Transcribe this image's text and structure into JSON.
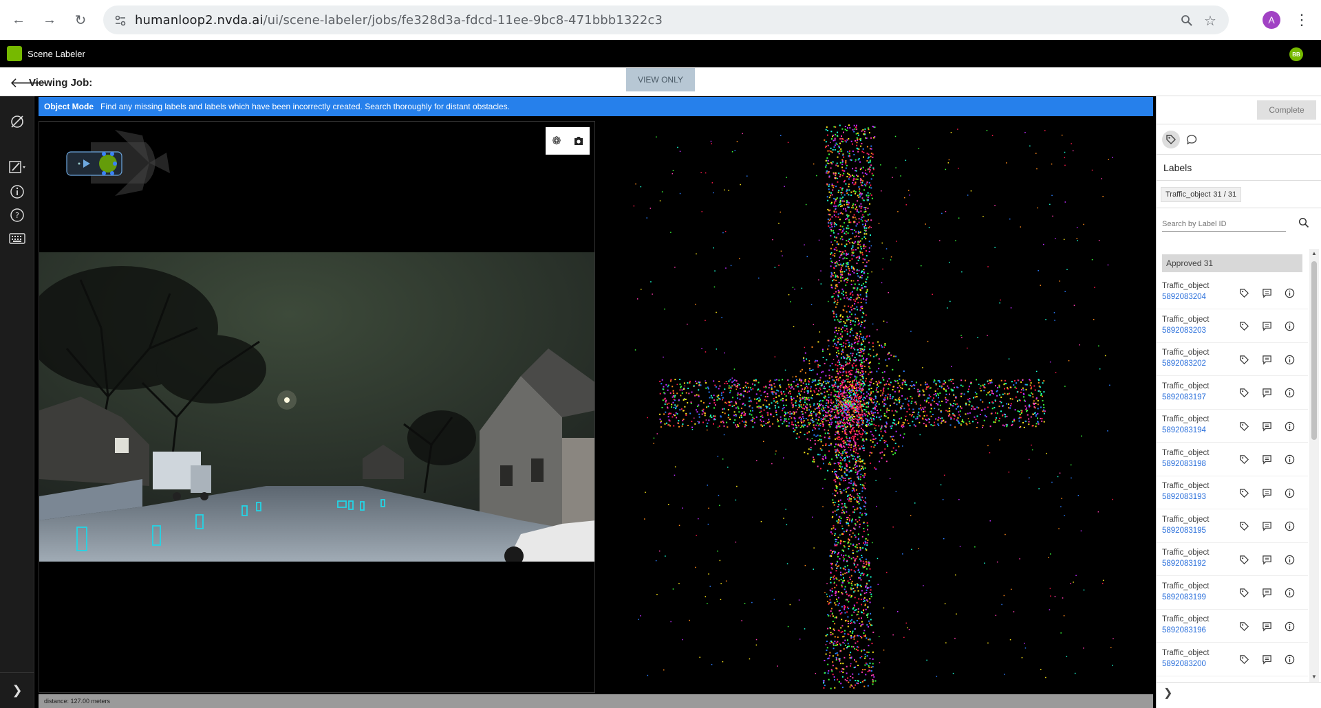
{
  "browser": {
    "url_host": "humanloop2.nvda.ai",
    "url_path": "/ui/scene-labeler/jobs/fe328d3a-fdcd-11ee-9bc8-471bbb1322c3",
    "profile_initial": "A"
  },
  "app": {
    "name": "Scene Labeler",
    "user_initials": "BB",
    "brand_color": "#76b900"
  },
  "job_bar": {
    "title": "Viewing Job:",
    "view_only_label": "VIEW ONLY"
  },
  "mode_banner": {
    "mode": "Object Mode",
    "instructions": "Find any missing labels and labels which have been incorrectly created. Search thoroughly for distant obstacles.",
    "color": "#2680eb"
  },
  "status_bar": {
    "text": "distance: 127.00 meters"
  },
  "right_panel": {
    "complete_label": "Complete",
    "labels_heading": "Labels",
    "chip_name": "Traffic_object",
    "chip_count": "31 / 31",
    "search_placeholder": "Search by Label ID",
    "approved_group": "Approved 31",
    "items": [
      {
        "type": "Traffic_object",
        "id": "5892083204"
      },
      {
        "type": "Traffic_object",
        "id": "5892083203"
      },
      {
        "type": "Traffic_object",
        "id": "5892083202"
      },
      {
        "type": "Traffic_object",
        "id": "5892083197"
      },
      {
        "type": "Traffic_object",
        "id": "5892083194"
      },
      {
        "type": "Traffic_object",
        "id": "5892083198"
      },
      {
        "type": "Traffic_object",
        "id": "5892083193"
      },
      {
        "type": "Traffic_object",
        "id": "5892083195"
      },
      {
        "type": "Traffic_object",
        "id": "5892083192"
      },
      {
        "type": "Traffic_object",
        "id": "5892083199"
      },
      {
        "type": "Traffic_object",
        "id": "5892083196"
      },
      {
        "type": "Traffic_object",
        "id": "5892083200"
      }
    ]
  }
}
